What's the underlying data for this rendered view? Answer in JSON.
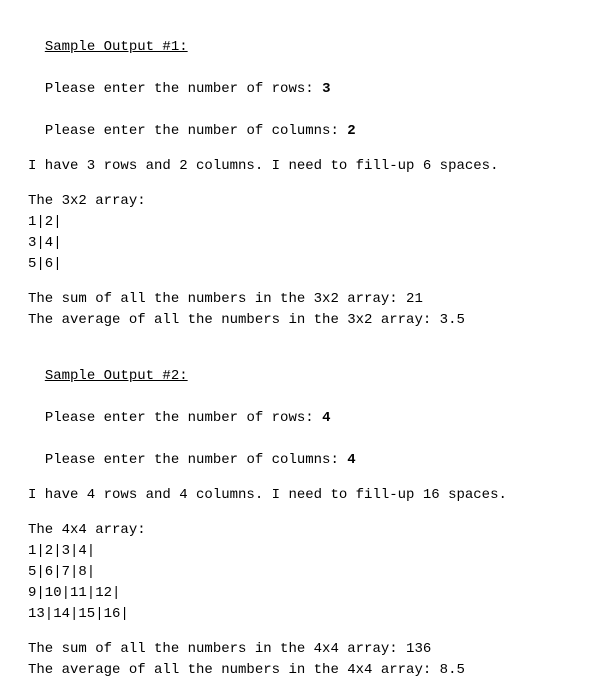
{
  "sample1": {
    "heading": "Sample Output #1:",
    "rows_prompt": "Please enter the number of rows: ",
    "rows_value": "3",
    "cols_prompt": "Please enter the number of columns: ",
    "cols_value": "2",
    "info": "I have 3 rows and 2 columns. I need to fill-up 6 spaces.",
    "array_label": "The 3x2 array:",
    "array_rows": [
      "1|2|",
      "3|4|",
      "5|6|"
    ],
    "sum_line": "The sum of all the numbers in the 3x2 array: 21",
    "avg_line": "The average of all the numbers in the 3x2 array: 3.5"
  },
  "sample2": {
    "heading": "Sample Output #2:",
    "rows_prompt": "Please enter the number of rows: ",
    "rows_value": "4",
    "cols_prompt": "Please enter the number of columns: ",
    "cols_value": "4",
    "info": "I have 4 rows and 4 columns. I need to fill-up 16 spaces.",
    "array_label": "The 4x4 array:",
    "array_rows": [
      "1|2|3|4|",
      "5|6|7|8|",
      "9|10|11|12|",
      "13|14|15|16|"
    ],
    "sum_line": "The sum of all the numbers in the 4x4 array: 136",
    "avg_line": "The average of all the numbers in the 4x4 array: 8.5"
  }
}
